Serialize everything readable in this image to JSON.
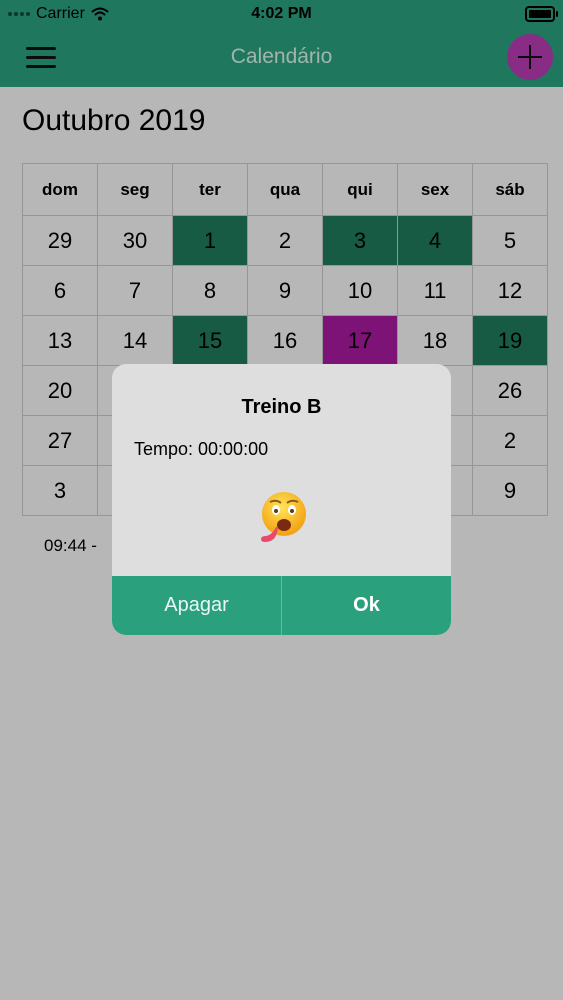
{
  "status": {
    "carrier": "Carrier",
    "time": "4:02 PM"
  },
  "nav": {
    "title": "Calendário"
  },
  "calendar": {
    "month": "Outubro 2019",
    "weekdays": [
      "dom",
      "seg",
      "ter",
      "qua",
      "qui",
      "sex",
      "sáb"
    ],
    "rows": [
      [
        "29",
        "30",
        "1",
        "2",
        "3",
        "4",
        "5"
      ],
      [
        "6",
        "7",
        "8",
        "9",
        "10",
        "11",
        "12"
      ],
      [
        "13",
        "14",
        "15",
        "16",
        "17",
        "18",
        "19"
      ],
      [
        "20",
        "",
        "",
        "",
        "",
        "",
        "26"
      ],
      [
        "27",
        "",
        "",
        "",
        "",
        "",
        "2"
      ],
      [
        "3",
        "",
        "",
        "",
        "",
        "",
        "9"
      ]
    ],
    "green_color": "#1f7a5c",
    "magenta_color": "#a7189f"
  },
  "note": "09:44 -",
  "dialog": {
    "title": "Treino B",
    "time_text": "Tempo: 00:00:00",
    "emoji_icon": "exhausted-face-emoji",
    "delete_label": "Apagar",
    "ok_label": "Ok"
  },
  "colors": {
    "accent": "#2aa17c",
    "add_button": "#b63bb2"
  }
}
